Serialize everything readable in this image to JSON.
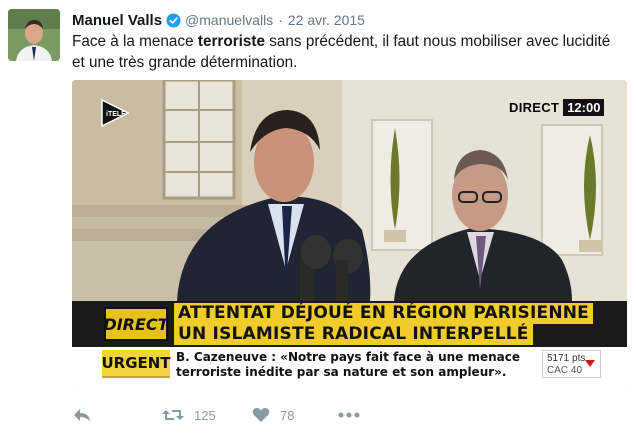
{
  "tweet": {
    "author_name": "Manuel Valls",
    "handle": "@manuelvalls",
    "separator": "·",
    "date": "22 avr. 2015",
    "text_before": "Face à la menace ",
    "text_bold": "terroriste",
    "text_after": " sans précédent, il faut nous mobiliser avec lucidité et une très grande détermination."
  },
  "media": {
    "channel": "iTELE",
    "live_label": "DIRECT",
    "live_time": "12:00",
    "banner_logo": "DIRECT",
    "banner_line1": "ATTENTAT DÉJOUÉ EN RÉGION PARISIENNE",
    "banner_line2": "UN ISLAMISTE RADICAL INTERPELLÉ",
    "urgent_label": "URGENT",
    "ticker_text": "B. Cazeneuve : «Notre pays fait face à une menace terroriste inédite par sa nature et son ampleur».",
    "market_points": "5171 pts",
    "market_index": "CAC 40"
  },
  "actions": {
    "retweet_count": "125",
    "like_count": "78"
  },
  "colors": {
    "muted": "#657786",
    "verified": "#1da1f2",
    "banner_yellow": "#f0cc2a"
  }
}
